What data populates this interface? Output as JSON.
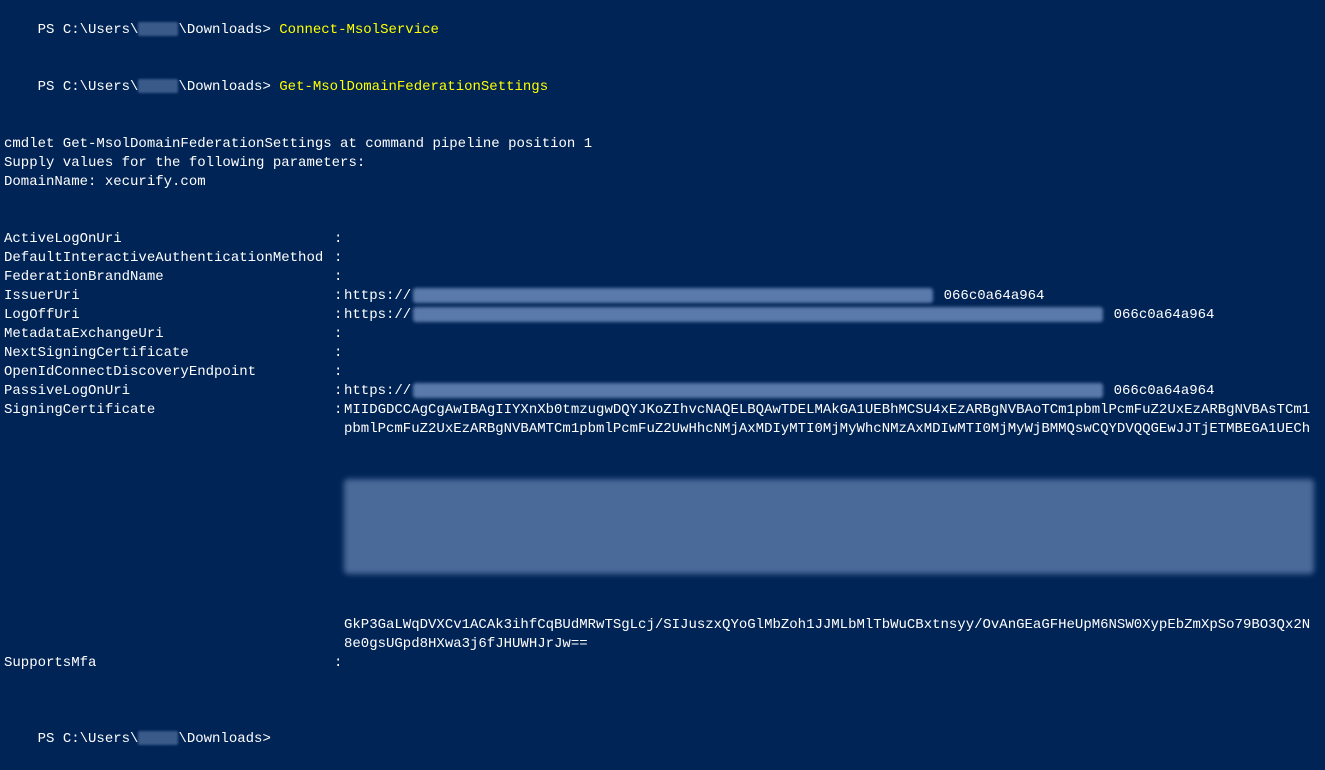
{
  "prompt": {
    "prefix": "PS C:\\Users\\",
    "suffix": "\\Downloads>"
  },
  "commands": {
    "cmd1": "Connect-MsolService",
    "cmd2": "Get-MsolDomainFederationSettings"
  },
  "cmdlet_info": {
    "line1": "cmdlet Get-MsolDomainFederationSettings at command pipeline position 1",
    "line2": "Supply values for the following parameters:",
    "line3": "DomainName: xecurify.com"
  },
  "kv": {
    "ActiveLogOnUri": {
      "key": "ActiveLogOnUri",
      "val": ""
    },
    "DefaultInteractiveAuthenticationMethod": {
      "key": "DefaultInteractiveAuthenticationMethod",
      "val": ""
    },
    "FederationBrandName": {
      "key": "FederationBrandName",
      "val": ""
    },
    "IssuerUri": {
      "key": "IssuerUri",
      "prefix": "https://",
      "suffix": "066c0a64a964"
    },
    "LogOffUri": {
      "key": "LogOffUri",
      "prefix": "https://",
      "suffix": "066c0a64a964"
    },
    "MetadataExchangeUri": {
      "key": "MetadataExchangeUri",
      "val": ""
    },
    "NextSigningCertificate": {
      "key": "NextSigningCertificate",
      "val": ""
    },
    "OpenIdConnectDiscoveryEndpoint": {
      "key": "OpenIdConnectDiscoveryEndpoint",
      "val": ""
    },
    "PassiveLogOnUri": {
      "key": "PassiveLogOnUri",
      "prefix": "https://",
      "suffix": "066c0a64a964"
    },
    "SigningCertificate": {
      "key": "SigningCertificate",
      "line1": "MIIDGDCCAgCgAwIBAgIIYXnXb0tmzugwDQYJKoZIhvcNAQELBQAwTDELMAkGA1UEBhMCSU4xEzARBgNVBAoTCm1pbmlPcmFuZ2UxEzARBgNVBAsTCm1",
      "line2": "pbmlPcmFuZ2UxEzARBgNVBAMTCm1pbmlPcmFuZ2UwHhcNMjAxMDIyMTI0MjMyWhcNMzAxMDIwMTI0MjMyWjBMMQswCQYDVQQGEwJJTjETMBEGA1UECh",
      "tail1": "GkP3GaLWqDVXCv1ACAk3ihfCqBUdMRwTSgLcj/SIJuszxQYoGlMbZoh1JJMLbMlTbWuCBxtnsyy/OvAnGEaGFHeUpM6NSW0XypEbZmXpSo79BO3Qx2N",
      "tail2": "8e0gsUGpd8HXwa3j6fJHUWHJrJw=="
    },
    "SupportsMfa": {
      "key": "SupportsMfa",
      "val": ""
    }
  },
  "sep": ":"
}
